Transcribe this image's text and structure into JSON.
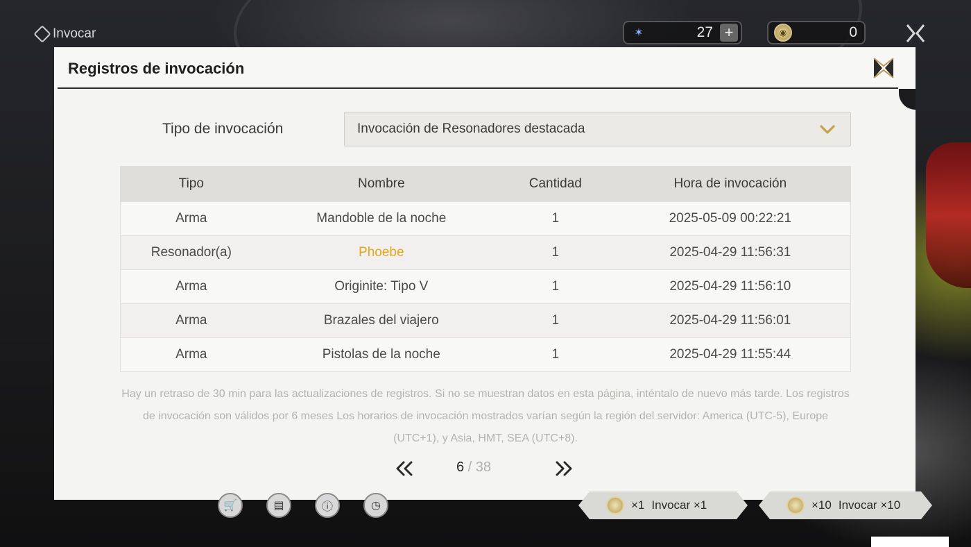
{
  "topbar": {
    "title": "Invocar",
    "currency_1": {
      "icon": "astrite-star-icon",
      "value": "27"
    },
    "currency_2": {
      "icon": "tide-coin-icon",
      "value": "0"
    }
  },
  "modal": {
    "title": "Registros de invocación",
    "type_label": "Tipo de invocación",
    "type_selected": "Invocación de Resonadores destacada",
    "table": {
      "headers": [
        "Tipo",
        "Nombre",
        "Cantidad",
        "Hora de invocación"
      ],
      "rows": [
        {
          "tipo": "Arma",
          "nombre": "Mandoble de la noche",
          "cantidad": "1",
          "hora": "2025-05-09 00:22:21",
          "highlight": false
        },
        {
          "tipo": "Resonador(a)",
          "nombre": "Phoebe",
          "cantidad": "1",
          "hora": "2025-04-29 11:56:31",
          "highlight": true
        },
        {
          "tipo": "Arma",
          "nombre": "Originite: Tipo V",
          "cantidad": "1",
          "hora": "2025-04-29 11:56:10",
          "highlight": false
        },
        {
          "tipo": "Arma",
          "nombre": "Brazales del viajero",
          "cantidad": "1",
          "hora": "2025-04-29 11:56:01",
          "highlight": false
        },
        {
          "tipo": "Arma",
          "nombre": "Pistolas de la noche",
          "cantidad": "1",
          "hora": "2025-04-29 11:55:44",
          "highlight": false
        }
      ]
    },
    "note": "Hay un retraso de 30 min para las actualizaciones de registros. Si no se muestran datos en esta página, inténtalo de nuevo más tarde. Los registros de invocación son válidos por 6 meses Los horarios de invocación mostrados varían según la región del servidor: America (UTC-5), Europe (UTC+1), y Asia, HMT, SEA (UTC+8).",
    "pager": {
      "current": "6",
      "separator": " / ",
      "total": "38"
    }
  },
  "bottom": {
    "pull1": {
      "count": "×1",
      "label": "Invocar ×1"
    },
    "pull10": {
      "count": "×10",
      "label": "Invocar ×10"
    }
  },
  "colors": {
    "highlight": "#e0a818",
    "modal_bg": "#f4f4f2",
    "header_row": "#dfdedb"
  }
}
